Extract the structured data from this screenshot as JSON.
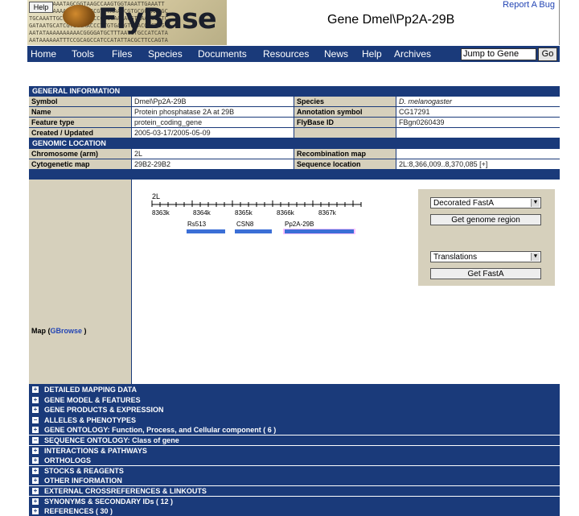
{
  "header": {
    "help_label": "Help",
    "logo_text": "FlyBase",
    "gene_title": "Gene Dmel\\Pp2A-29B",
    "report_bug": "Report A Bug",
    "dna_lines": [
      "GGGATTGAAATAGCGGTAAGCCAAGTGGTAAATTGAAATT",
      "AATTGATAAAAGTATGACCCGTTTAAAGCGTGCGCTAACGC",
      "TGCAAATTGCCGCACCTCACCGCCCAAAAGGTAAATCGTTC",
      "GATAATGCATCGTGGCAACCCTTGTGAAGTGCACGCCTGG",
      "AATATAAAAAAAAAACGGGGATGCTTTAATGTGCCATCATA",
      "AATAAAAAATTTCCGCAGCCATCCATATTACGCTTCCAGTA"
    ]
  },
  "nav": {
    "items": [
      "Home",
      "Tools",
      "Files",
      "Species",
      "Documents",
      "Resources",
      "News",
      "Help",
      "Archives"
    ],
    "jump_label": "Jump to Gene",
    "go_label": "Go"
  },
  "general": {
    "title": "GENERAL INFORMATION",
    "rows": [
      {
        "l1": "Symbol",
        "v1": "Dmel\\Pp2A-29B",
        "l2": "Species",
        "v2": "D. melanogaster"
      },
      {
        "l1": "Name",
        "v1": "Protein phosphatase 2A at 29B",
        "l2": "Annotation symbol",
        "v2": "CG17291"
      },
      {
        "l1": "Feature type",
        "v1": "protein_coding_gene",
        "l2": "FlyBase ID",
        "v2": "FBgn0260439"
      },
      {
        "l1": "Created / Updated",
        "v1": "2005-03-17/2005-05-09",
        "l2": "",
        "v2": ""
      }
    ]
  },
  "genomic": {
    "title": "GENOMIC LOCATION",
    "rows": [
      {
        "l1": "Chromosome (arm)",
        "v1": "2L",
        "l2": "Recombination map",
        "v2": ""
      },
      {
        "l1": "Cytogenetic map",
        "v1": "29B2-29B2",
        "l2": "Sequence location",
        "v2": "2L:8,366,009..8,370,085 [+]"
      }
    ],
    "map_label": "Map (",
    "map_link": "GBrowse",
    "map_label_end": " )",
    "map": {
      "chrom_label": "2L",
      "ticks": [
        "8363k",
        "8364k",
        "8365k",
        "8366k",
        "8367k"
      ],
      "genes": [
        "Rs513",
        "CSN8",
        "Pp2A-29B"
      ]
    },
    "fasta": {
      "select1": "Decorated FastA",
      "button1": "Get genome region",
      "select2": "Translations",
      "button2": "Get FastA"
    }
  },
  "sections": [
    "DETAILED MAPPING DATA",
    "GENE MODEL & FEATURES",
    "GENE PRODUCTS & EXPRESSION",
    "ALLELES & PHENOTYPES",
    "GENE ONTOLOGY: Function, Process, and Cellular component ( 6 )",
    "SEQUENCE ONTOLOGY: Class of gene",
    "INTERACTIONS & PATHWAYS",
    "ORTHOLOGS",
    "STOCKS & REAGENTS",
    "OTHER INFORMATION",
    "EXTERNAL CROSSREFERENCES & LINKOUTS",
    "SYNONYMS & SECONDARY IDs ( 12 )",
    "REFERENCES ( 30 )"
  ],
  "colors": {
    "nav_bg": "#1a3a7a",
    "label_bg": "#d6d0bc",
    "gene_box": "#3b6fd6",
    "link": "#2345b4"
  }
}
